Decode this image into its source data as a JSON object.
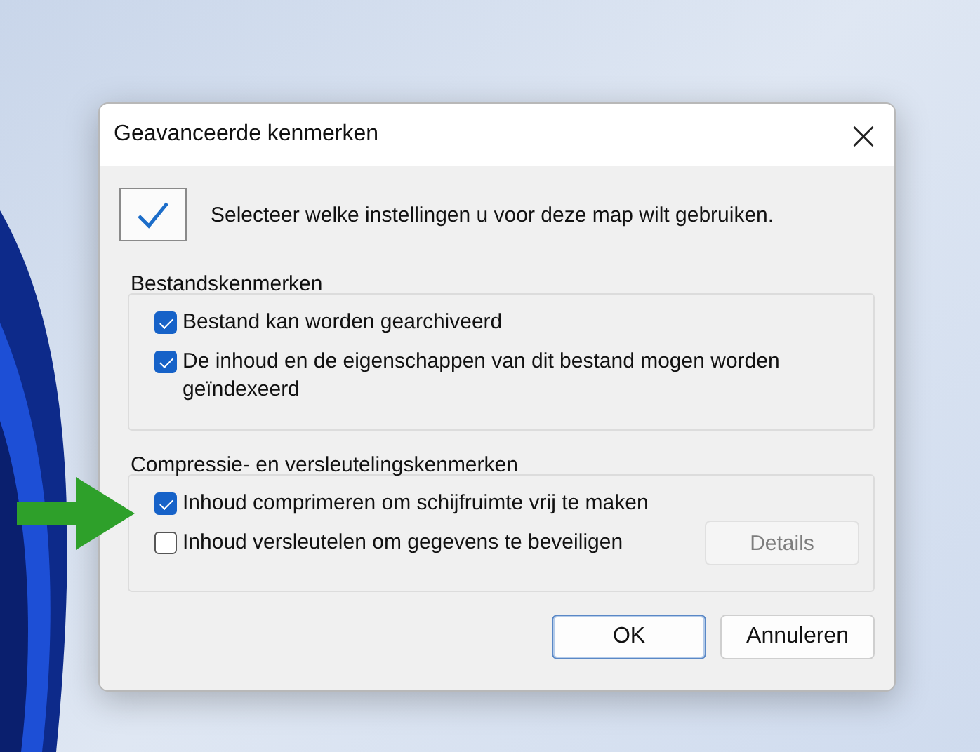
{
  "window": {
    "title": "Geavanceerde kenmerken",
    "close": "×"
  },
  "intro": "Selecteer welke instellingen u voor deze map wilt gebruiken.",
  "groups": [
    {
      "title": "Bestandskenmerken",
      "options": [
        {
          "label": "Bestand kan worden gearchiveerd",
          "checked": true
        },
        {
          "label": "De inhoud en de eigenschappen van dit bestand mogen worden geïndexeerd",
          "checked": true
        }
      ]
    },
    {
      "title": "Compressie- en versleutelingskenmerken",
      "options": [
        {
          "label": "Inhoud comprimeren om schijfruimte vrij te maken",
          "checked": true
        },
        {
          "label": "Inhoud versleutelen om gegevens te beveiligen",
          "checked": false,
          "button": {
            "label": "Details",
            "disabled": true
          }
        }
      ]
    }
  ],
  "buttons": [
    {
      "label": "OK",
      "default": true
    },
    {
      "label": "Annuleren",
      "default": false
    }
  ]
}
